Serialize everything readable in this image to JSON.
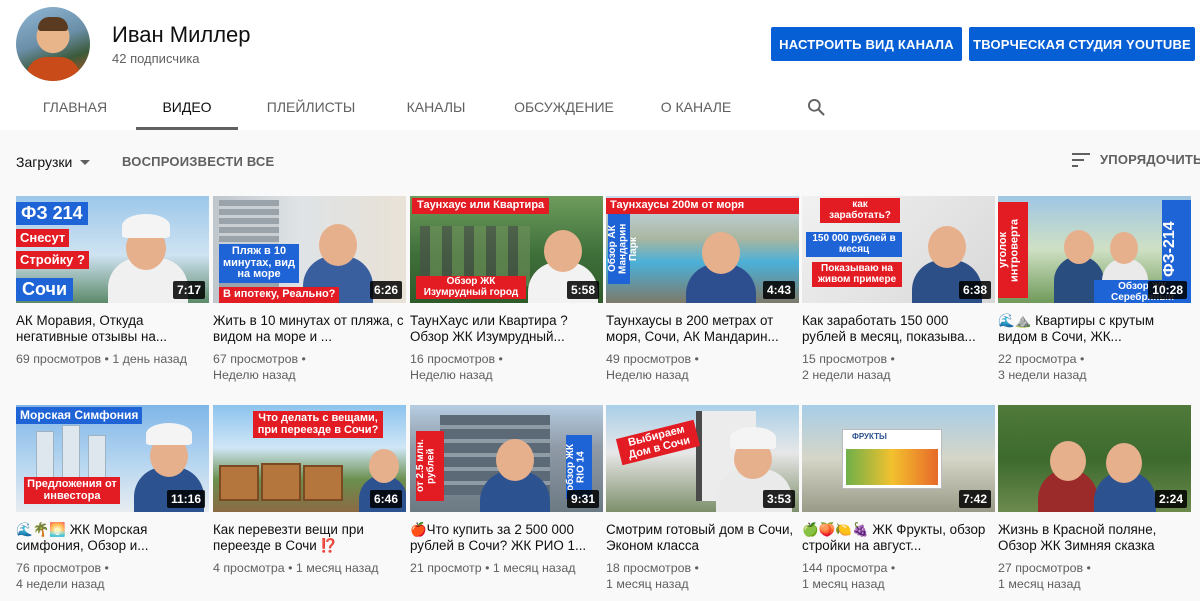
{
  "channel": {
    "name": "Иван Миллер",
    "subscribers": "42 подписчика",
    "customize_label": "НАСТРОИТЬ ВИД КАНАЛА",
    "studio_label": "ТВОРЧЕСКАЯ СТУДИЯ YOUTUBE"
  },
  "tabs": [
    {
      "label": "ГЛАВНАЯ",
      "active": false
    },
    {
      "label": "ВИДЕО",
      "active": true
    },
    {
      "label": "ПЛЕЙЛИСТЫ",
      "active": false
    },
    {
      "label": "КАНАЛЫ",
      "active": false
    },
    {
      "label": "ОБСУЖДЕНИЕ",
      "active": false
    },
    {
      "label": "О КАНАЛЕ",
      "active": false
    }
  ],
  "toolbar": {
    "uploads_label": "Загрузки",
    "play_all_label": "ВОСПРОИЗВЕСТИ ВСЕ",
    "sort_label": "УПОРЯДОЧИТЬ"
  },
  "colors": {
    "accent": "#065fd4",
    "thumb_red": "#e31b23",
    "thumb_blue": "#1f64d6"
  },
  "videos": [
    {
      "title": "АК Моравия, Откуда негативные отзывы на...",
      "views": "69 просмотров",
      "age": "1 день назад",
      "duration": "7:17",
      "thumb": {
        "l1": "ФЗ 214",
        "l2": "Снесут",
        "l3": "Стройку ?",
        "l4": "Сочи"
      }
    },
    {
      "title": "Жить в 10 минутах от пляжа, с видом на море и ...",
      "views": "67 просмотров",
      "age": "Неделю назад",
      "duration": "6:26",
      "thumb": {
        "l1": "Пляж в 10 минутах, вид на море",
        "l2": "В ипотеку, Реально?"
      }
    },
    {
      "title": "ТаунХаус или Квартира ? Обзор ЖК Изумрудный...",
      "views": "16 просмотров",
      "age": "Неделю назад",
      "duration": "5:58",
      "thumb": {
        "l1": "Таунхаус или Квартира",
        "l2": "Обзор ЖК Изумрудный город"
      }
    },
    {
      "title": "Таунхаусы в 200 метрах от моря, Сочи, АК Мандарин...",
      "views": "49 просмотров",
      "age": "Неделю назад",
      "duration": "4:43",
      "thumb": {
        "l1": "Таунхаусы 200м от моря",
        "l2": "Обзор АК Мандарин Парк"
      }
    },
    {
      "title": "Как заработать 150 000 рублей в месяц, показыва...",
      "views": "15 просмотров",
      "age": "2 недели назад",
      "duration": "6:38",
      "thumb": {
        "l1": "как заработать?",
        "l2": "150 000 рублей в месяц",
        "l3": "Показываю на живом примере"
      }
    },
    {
      "title": "🌊⛰️ Квартиры с крутым видом в Сочи, ЖК...",
      "views": "22 просмотра",
      "age": "3 недели назад",
      "duration": "10:28",
      "thumb": {
        "l1": "уголок интроверта",
        "l2": "ФЗ-214",
        "l3": "Обзор ЖК Серебряный"
      }
    },
    {
      "title": "🌊🌴🌅 ЖК Морская симфония, Обзор и...",
      "views": "76 просмотров",
      "age": "4 недели назад",
      "duration": "11:16",
      "thumb": {
        "l1": "Морская Симфония",
        "l2": "Предложения от инвестора"
      }
    },
    {
      "title": "Как перевезти вещи при переезде в Сочи ⁉️",
      "views": "4 просмотра",
      "age": "1 месяц назад",
      "duration": "6:46",
      "thumb": {
        "l1": "Что делать с вещами, при переезде в Сочи?"
      }
    },
    {
      "title": "🍎Что купить за 2 500 000 рублей в Сочи? ЖК РИО 1...",
      "views": "21 просмотр",
      "age": "1 месяц назад",
      "duration": "9:31",
      "thumb": {
        "l1": "от 2.5 млн. рублей",
        "l2": "обзор ЖК RIO 14"
      }
    },
    {
      "title": "Смотрим готовый дом в Сочи, Эконом класса",
      "views": "18 просмотров",
      "age": "1 месяц назад",
      "duration": "3:53",
      "thumb": {
        "l1": "Выбираем Дом в Сочи"
      }
    },
    {
      "title": "🍏🍑🍋🍇 ЖК Фрукты, обзор стройки на август...",
      "views": "144 просмотра",
      "age": "1 месяц назад",
      "duration": "7:42",
      "thumb": {
        "l1": "ФРУКТЫ"
      }
    },
    {
      "title": "Жизнь в Красной поляне, Обзор ЖК Зимняя сказка",
      "views": "27 просмотров",
      "age": "1 месяц назад",
      "duration": "2:24",
      "thumb": {}
    }
  ]
}
